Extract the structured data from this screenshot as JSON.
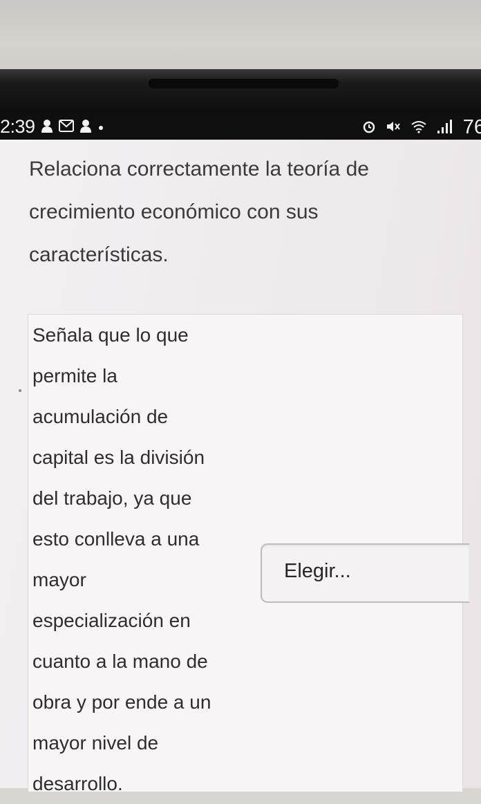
{
  "status_bar": {
    "time": "2:39",
    "notification_icons": [
      "person-icon",
      "gmail-icon",
      "person-icon",
      "dot-icon"
    ],
    "system_icons": [
      "alarm-icon",
      "mute-icon",
      "wifi-6-icon",
      "signal-icon"
    ],
    "battery": "76"
  },
  "question": {
    "lines": [
      "Relaciona correctamente la teoría de",
      "crecimiento económico con sus",
      "características."
    ]
  },
  "item": {
    "text_lines": [
      "Señala que lo que",
      "permite la",
      "acumulación de",
      "capital es la división",
      "del trabajo, ya que",
      "esto conlleva a una",
      "mayor",
      "especialización en",
      "cuanto a la mano de",
      "obra y por ende a un",
      "mayor nivel de",
      "desarrollo."
    ],
    "select_value": "Elegir..."
  }
}
